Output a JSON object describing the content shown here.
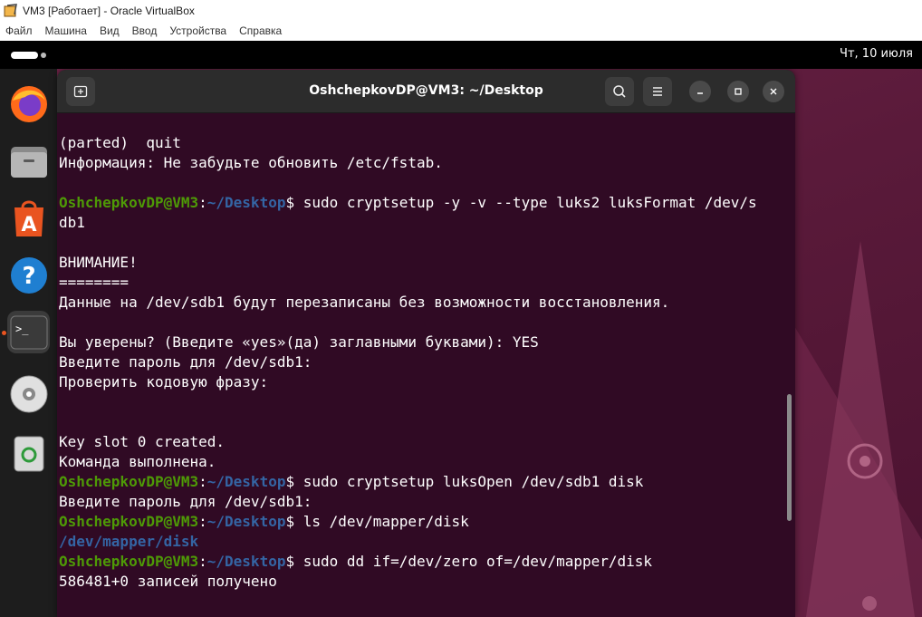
{
  "vbox": {
    "title": "VM3 [Работает] - Oracle VirtualBox",
    "menu": [
      "Файл",
      "Машина",
      "Вид",
      "Ввод",
      "Устройства",
      "Справка"
    ]
  },
  "topbar": {
    "clock": "Чт, 10 июля"
  },
  "dock": {
    "items": [
      {
        "name": "firefox-icon"
      },
      {
        "name": "files-icon"
      },
      {
        "name": "app-center-icon"
      },
      {
        "name": "help-icon"
      },
      {
        "name": "terminal-icon",
        "active": true
      },
      {
        "name": "disc-icon"
      },
      {
        "name": "trash-icon"
      }
    ]
  },
  "terminal": {
    "title": "OshchepkovDP@VM3: ~/Desktop",
    "prompt_user": "OshchepkovDP@VM3",
    "prompt_colon": ":",
    "prompt_path": "~/Desktop",
    "prompt_dollar": "$",
    "lines": [
      {
        "type": "text",
        "text": "(parted)  quit"
      },
      {
        "type": "text",
        "text": "Информация: Не забудьте обновить /etc/fstab."
      },
      {
        "type": "text",
        "text": ""
      },
      {
        "type": "cmd",
        "text": " sudo cryptsetup -y -v --type luks2 luksFormat /dev/s"
      },
      {
        "type": "text",
        "text": "db1"
      },
      {
        "type": "text",
        "text": ""
      },
      {
        "type": "text",
        "text": "ВНИМАНИЕ!"
      },
      {
        "type": "text",
        "text": "========"
      },
      {
        "type": "text",
        "text": "Данные на /dev/sdb1 будут перезаписаны без возможности восстановления."
      },
      {
        "type": "text",
        "text": ""
      },
      {
        "type": "text",
        "text": "Вы уверены? (Введите «yes»(да) заглавными буквами): YES"
      },
      {
        "type": "text",
        "text": "Введите пароль для /dev/sdb1:"
      },
      {
        "type": "text",
        "text": "Проверить кодовую фразу:"
      },
      {
        "type": "text",
        "text": ""
      },
      {
        "type": "text",
        "text": ""
      },
      {
        "type": "text",
        "text": "Key slot 0 created."
      },
      {
        "type": "text",
        "text": "Команда выполнена."
      },
      {
        "type": "cmd",
        "text": " sudo cryptsetup luksOpen /dev/sdb1 disk"
      },
      {
        "type": "text",
        "text": "Введите пароль для /dev/sdb1:"
      },
      {
        "type": "cmd",
        "text": " ls /dev/mapper/disk"
      },
      {
        "type": "link",
        "text": "/dev/mapper/disk"
      },
      {
        "type": "cmd",
        "text": " sudo dd if=/dev/zero of=/dev/mapper/disk"
      },
      {
        "type": "text",
        "text": "586481+0 записей получено"
      }
    ]
  },
  "colors": {
    "terminal_bg": "#300a24",
    "prompt_user": "#4e9a06",
    "prompt_path": "#3465a4",
    "ubuntu_orange": "#e95420"
  }
}
